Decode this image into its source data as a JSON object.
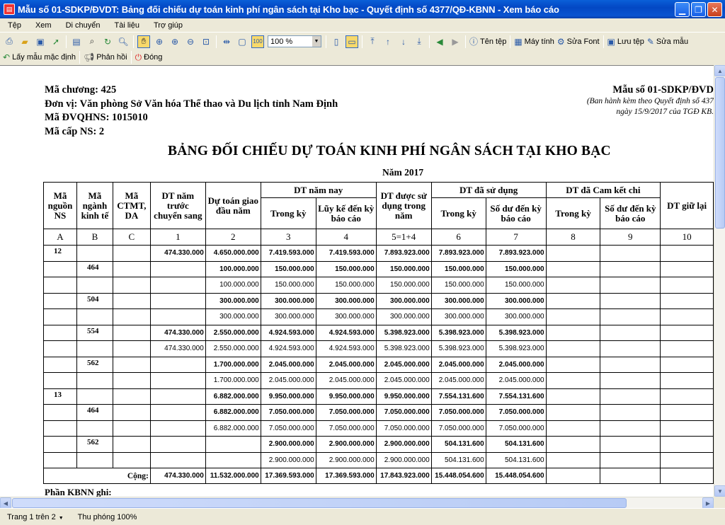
{
  "window": {
    "title": "Mẫu số 01-SDKP/ĐVDT: Bảng đối chiếu dự toán kinh phí ngân sách tại Kho bạc - Quyết định số 4377/QĐ-KBNN - Xem báo cáo",
    "icon": "report-app-icon"
  },
  "menu": [
    "Tệp",
    "Xem",
    "Di chuyển",
    "Tài liệu",
    "Trợ giúp"
  ],
  "toolbar1": {
    "zoom_value": "100 %",
    "buttons": {
      "file_name": "Tên tệp",
      "calculator": "Máy tính",
      "fix_font": "Sửa Font",
      "save_file": "Lưu tệp",
      "edit_template": "Sửa mẫu"
    }
  },
  "toolbar2": {
    "default_template": "Lấy mẫu mặc định",
    "feedback": "Phản hồi",
    "close": "Đóng"
  },
  "report": {
    "ma_chuong": "Mã chương: 425",
    "don_vi": "Đơn vị: Văn phòng Sở Văn hóa Thể thao và Du lịch tỉnh Nam Định",
    "ma_dvqhns": "Mã ĐVQHNS: 1015010",
    "ma_cap_ns": "Mã cấp NS: 2",
    "form_no": "Mẫu số 01-SDKP/ĐVD",
    "decree_line1": "(Ban hành kèm theo Quyết định số 437",
    "decree_line2": "ngày 15/9/2017 của TGĐ KB.",
    "title": "BẢNG ĐỐI CHIẾU DỰ TOÁN KINH PHÍ NGÂN SÁCH TẠI KHO BẠC",
    "year": "Năm 2017",
    "headers": {
      "ma_nguon": "Mã nguồn NS",
      "ma_nganh": "Mã ngành kinh tế",
      "ma_ctmt": "Mã CTMT, DA",
      "dt_nam_truoc": "DT năm trước chuyển sang",
      "du_toan_dau_nam": "Dự toán giao đầu năm",
      "dt_nam_nay": "DT năm nay",
      "trong_ky": "Trong kỳ",
      "luy_ke": "Lũy kế đến kỳ báo cáo",
      "dt_duoc_sd": "DT được sử dụng trong năm",
      "dt_da_sd": "DT đã sử dụng",
      "trong_ky_2": "Trong kỳ",
      "so_du": "Số dư đến kỳ báo cáo",
      "dt_cam_ket": "DT đã Cam kết chi",
      "trong_ky_3": "Trong kỳ",
      "so_du_2": "Số dư đến kỳ báo cáo",
      "dt_giu_lai": "DT giữ lại"
    },
    "index_row": [
      "A",
      "B",
      "C",
      "1",
      "2",
      "3",
      "4",
      "5=1+4",
      "6",
      "7",
      "8",
      "9",
      "10"
    ],
    "rows": [
      {
        "bold": true,
        "cells": [
          "12",
          "",
          "",
          "474.330.000",
          "4.650.000.000",
          "7.419.593.000",
          "7.419.593.000",
          "7.893.923.000",
          "7.893.923.000",
          "7.893.923.000",
          "",
          "",
          ""
        ]
      },
      {
        "bold": true,
        "cells": [
          "",
          "464",
          "",
          "",
          "100.000.000",
          "150.000.000",
          "150.000.000",
          "150.000.000",
          "150.000.000",
          "150.000.000",
          "",
          "",
          ""
        ]
      },
      {
        "bold": false,
        "cells": [
          "",
          "",
          "",
          "",
          "100.000.000",
          "150.000.000",
          "150.000.000",
          "150.000.000",
          "150.000.000",
          "150.000.000",
          "",
          "",
          ""
        ]
      },
      {
        "bold": true,
        "cells": [
          "",
          "504",
          "",
          "",
          "300.000.000",
          "300.000.000",
          "300.000.000",
          "300.000.000",
          "300.000.000",
          "300.000.000",
          "",
          "",
          ""
        ]
      },
      {
        "bold": false,
        "cells": [
          "",
          "",
          "",
          "",
          "300.000.000",
          "300.000.000",
          "300.000.000",
          "300.000.000",
          "300.000.000",
          "300.000.000",
          "",
          "",
          ""
        ]
      },
      {
        "bold": true,
        "cells": [
          "",
          "554",
          "",
          "474.330.000",
          "2.550.000.000",
          "4.924.593.000",
          "4.924.593.000",
          "5.398.923.000",
          "5.398.923.000",
          "5.398.923.000",
          "",
          "",
          ""
        ]
      },
      {
        "bold": false,
        "cells": [
          "",
          "",
          "",
          "474.330.000",
          "2.550.000.000",
          "4.924.593.000",
          "4.924.593.000",
          "5.398.923.000",
          "5.398.923.000",
          "5.398.923.000",
          "",
          "",
          ""
        ]
      },
      {
        "bold": true,
        "cells": [
          "",
          "562",
          "",
          "",
          "1.700.000.000",
          "2.045.000.000",
          "2.045.000.000",
          "2.045.000.000",
          "2.045.000.000",
          "2.045.000.000",
          "",
          "",
          ""
        ]
      },
      {
        "bold": false,
        "cells": [
          "",
          "",
          "",
          "",
          "1.700.000.000",
          "2.045.000.000",
          "2.045.000.000",
          "2.045.000.000",
          "2.045.000.000",
          "2.045.000.000",
          "",
          "",
          ""
        ]
      },
      {
        "bold": true,
        "cells": [
          "13",
          "",
          "",
          "",
          "6.882.000.000",
          "9.950.000.000",
          "9.950.000.000",
          "9.950.000.000",
          "7.554.131.600",
          "7.554.131.600",
          "",
          "",
          ""
        ]
      },
      {
        "bold": true,
        "cells": [
          "",
          "464",
          "",
          "",
          "6.882.000.000",
          "7.050.000.000",
          "7.050.000.000",
          "7.050.000.000",
          "7.050.000.000",
          "7.050.000.000",
          "",
          "",
          ""
        ]
      },
      {
        "bold": false,
        "cells": [
          "",
          "",
          "",
          "",
          "6.882.000.000",
          "7.050.000.000",
          "7.050.000.000",
          "7.050.000.000",
          "7.050.000.000",
          "7.050.000.000",
          "",
          "",
          ""
        ]
      },
      {
        "bold": true,
        "cells": [
          "",
          "562",
          "",
          "",
          "",
          "2.900.000.000",
          "2.900.000.000",
          "2.900.000.000",
          "504.131.600",
          "504.131.600",
          "",
          "",
          ""
        ]
      },
      {
        "bold": false,
        "cells": [
          "",
          "",
          "",
          "",
          "",
          "2.900.000.000",
          "2.900.000.000",
          "2.900.000.000",
          "504.131.600",
          "504.131.600",
          "",
          "",
          ""
        ]
      }
    ],
    "total": {
      "label": "Cộng:",
      "cells": [
        "474.330.000",
        "11.532.000.000",
        "17.369.593.000",
        "17.369.593.000",
        "17.843.923.000",
        "15.448.054.600",
        "15.448.054.600",
        "",
        "",
        ""
      ]
    },
    "kbnn_note": "Phần KBNN ghi:"
  },
  "status": {
    "page": "Trang 1 trên 2",
    "zoom": "Thu phóng 100%"
  }
}
